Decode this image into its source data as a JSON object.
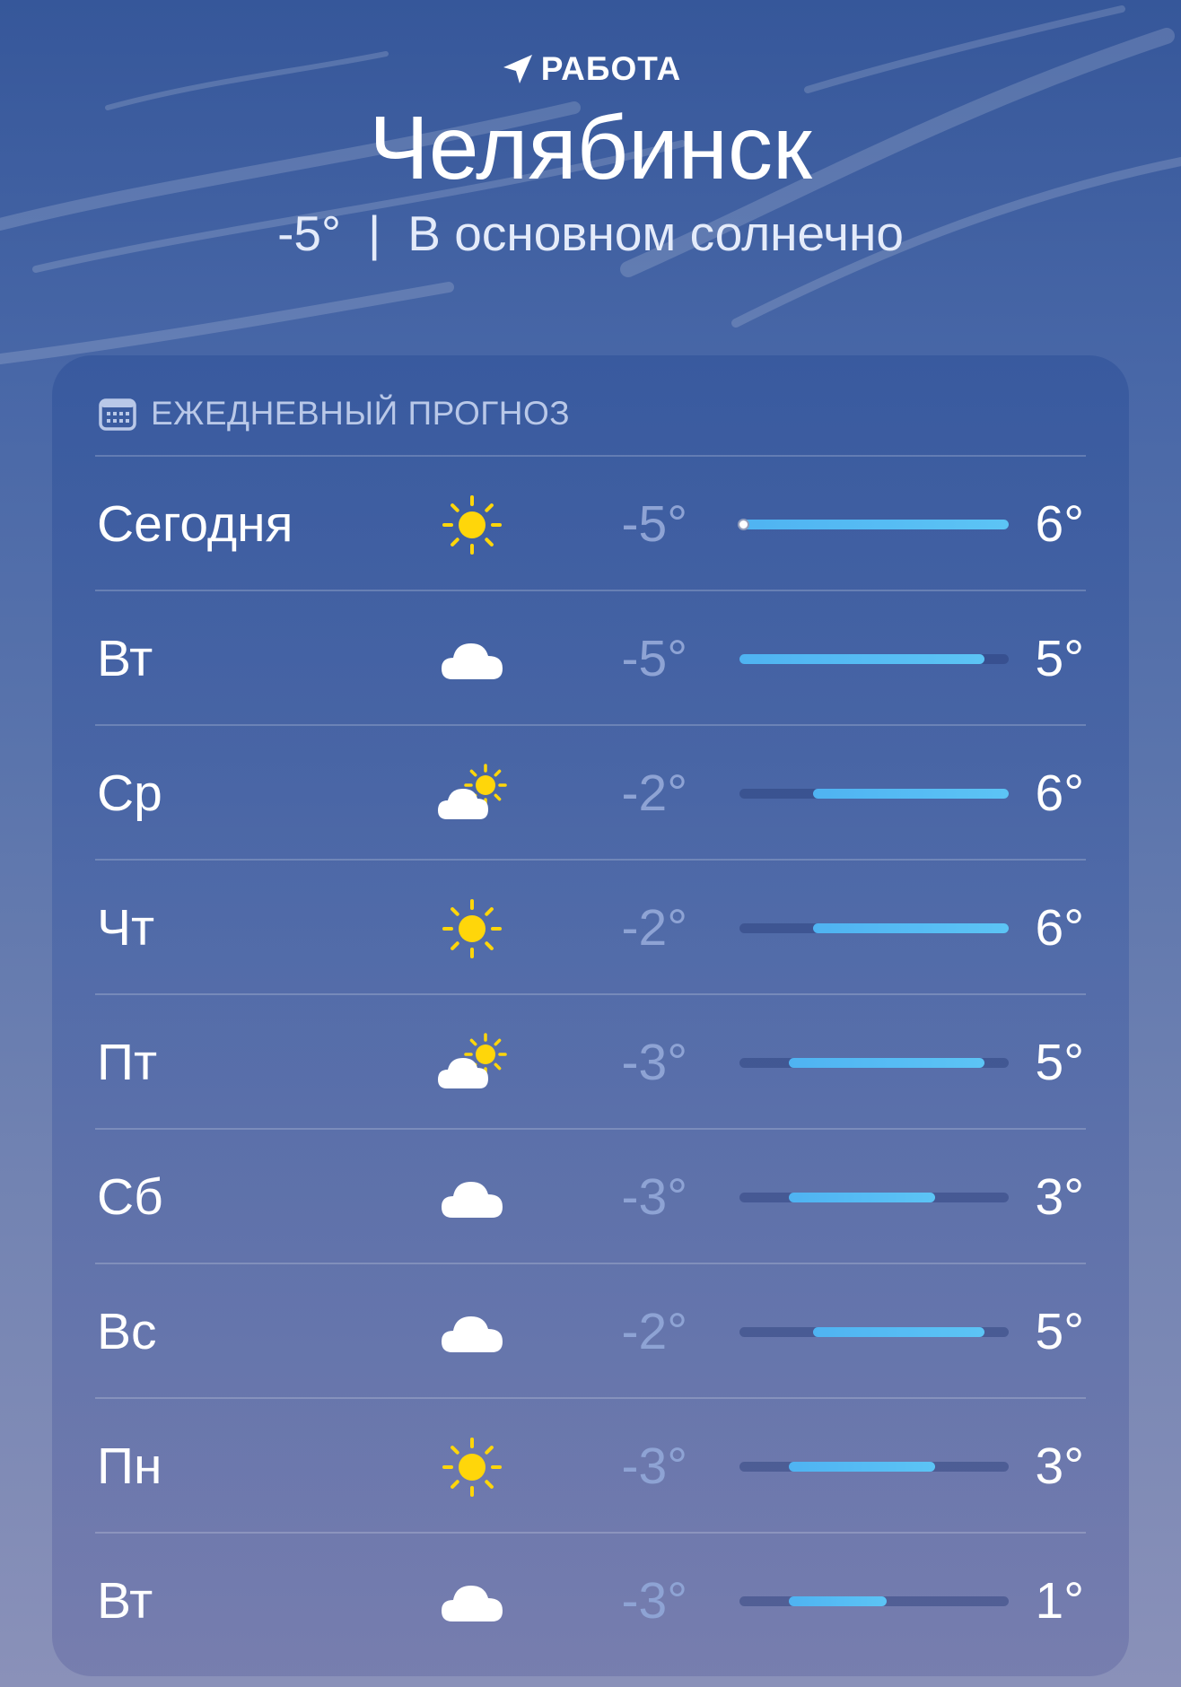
{
  "header": {
    "location_label": "РАБОТА",
    "location_icon": "location-arrow-icon",
    "city": "Челябинск",
    "current_temp": "-5°",
    "separator": "|",
    "condition": "В основном солнечно"
  },
  "forecast": {
    "title": "ЕЖЕДНЕВНЫЙ ПРОГНОЗ",
    "title_icon": "calendar-icon",
    "range_min": -5,
    "range_max": 6,
    "current_temp_value": -5,
    "days": [
      {
        "day": "Сегодня",
        "icon": "sun-icon",
        "low": "-5°",
        "high": "6°",
        "low_value": -5,
        "high_value": 6,
        "current": true
      },
      {
        "day": "Вт",
        "icon": "cloud-icon",
        "low": "-5°",
        "high": "5°",
        "low_value": -5,
        "high_value": 5
      },
      {
        "day": "Ср",
        "icon": "partly-cloudy-icon",
        "low": "-2°",
        "high": "6°",
        "low_value": -2,
        "high_value": 6
      },
      {
        "day": "Чт",
        "icon": "sun-icon",
        "low": "-2°",
        "high": "6°",
        "low_value": -2,
        "high_value": 6
      },
      {
        "day": "Пт",
        "icon": "partly-cloudy-icon",
        "low": "-3°",
        "high": "5°",
        "low_value": -3,
        "high_value": 5
      },
      {
        "day": "Сб",
        "icon": "cloud-icon",
        "low": "-3°",
        "high": "3°",
        "low_value": -3,
        "high_value": 3
      },
      {
        "day": "Вс",
        "icon": "cloud-icon",
        "low": "-2°",
        "high": "5°",
        "low_value": -2,
        "high_value": 5
      },
      {
        "day": "Пн",
        "icon": "sun-icon",
        "low": "-3°",
        "high": "3°",
        "low_value": -3,
        "high_value": 3
      },
      {
        "day": "Вт",
        "icon": "cloud-icon",
        "low": "-3°",
        "high": "1°",
        "low_value": -3,
        "high_value": 1
      }
    ]
  },
  "colors": {
    "sun": "#ffd60a",
    "cloud": "#ffffff",
    "bar": "#56bdf4",
    "low_text": "#8ea3d4"
  }
}
